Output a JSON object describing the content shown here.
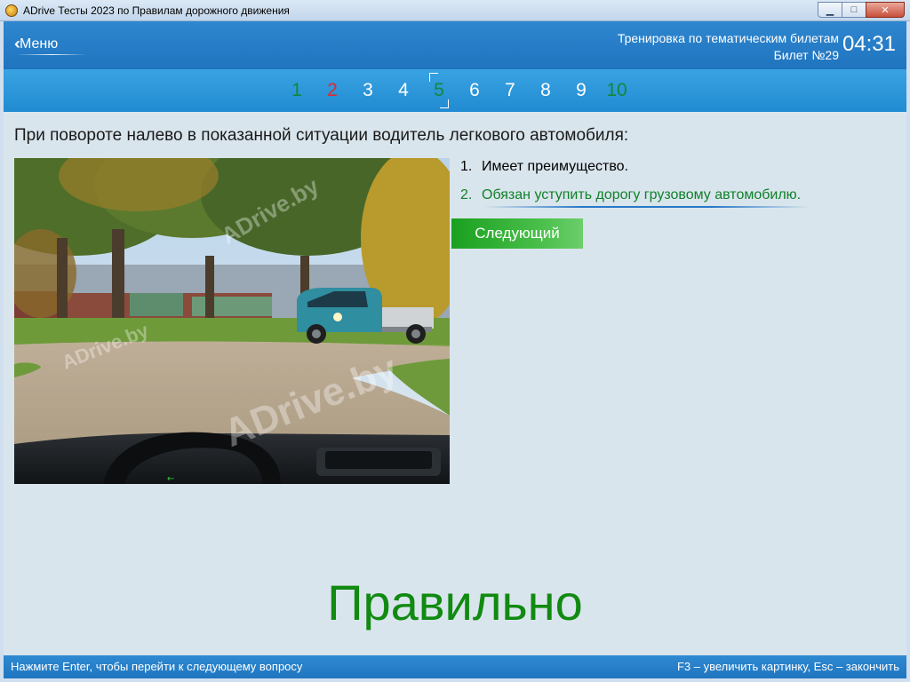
{
  "window": {
    "title": "ADrive Тесты 2023 по Правилам дорожного движения"
  },
  "header": {
    "menu_label": "Меню",
    "mode": "Тренировка по тематическим билетам",
    "ticket": "Билет №29",
    "timer": "04:31"
  },
  "questions": [
    {
      "label": "1",
      "status": "correct",
      "color": "#13873a"
    },
    {
      "label": "2",
      "status": "wrong",
      "color": "#e4282c"
    },
    {
      "label": "3",
      "status": "unanswered",
      "color": "#ffffff"
    },
    {
      "label": "4",
      "status": "unanswered",
      "color": "#ffffff"
    },
    {
      "label": "5",
      "status": "correct",
      "color": "#13873a",
      "current": true
    },
    {
      "label": "6",
      "status": "unanswered",
      "color": "#ffffff"
    },
    {
      "label": "7",
      "status": "unanswered",
      "color": "#ffffff"
    },
    {
      "label": "8",
      "status": "unanswered",
      "color": "#ffffff"
    },
    {
      "label": "9",
      "status": "unanswered",
      "color": "#ffffff"
    },
    {
      "label": "10",
      "status": "correct",
      "color": "#13873a"
    }
  ],
  "question_text": "При повороте налево в показанной ситуации водитель легкового автомобиля:",
  "answers": [
    {
      "num": "1.",
      "text": "Имеет преимущество."
    },
    {
      "num": "2.",
      "text": "Обязан уступить дорогу грузовому автомобилю."
    }
  ],
  "next_button": "Следующий",
  "result": "Правильно",
  "image": {
    "watermark": "ADrive.by"
  },
  "status": {
    "left": "Нажмите Enter, чтобы перейти к следующему вопросу",
    "right": "F3 – увеличить картинку, Esc – закончить"
  },
  "colors": {
    "correct": "#13873a",
    "wrong": "#e4282c",
    "accent": "#1f74be",
    "next_button": "#1aa020"
  }
}
